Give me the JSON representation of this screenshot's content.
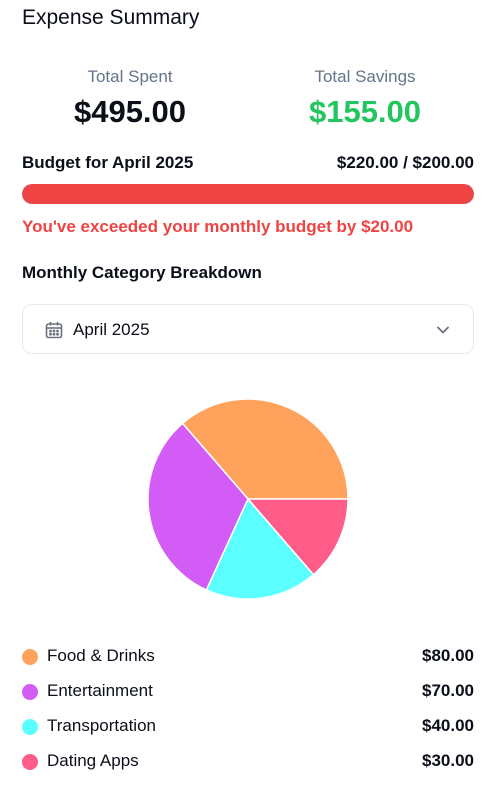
{
  "header": {
    "title": "Expense Summary"
  },
  "stats": {
    "total_spent": {
      "label": "Total Spent",
      "value": "$495.00"
    },
    "total_savings": {
      "label": "Total Savings",
      "value": "$155.00"
    }
  },
  "budget": {
    "label": "Budget for April 2025",
    "amount": "$220.00 / $200.00",
    "progress_fraction": 1.0,
    "warning": "You've exceeded your monthly budget by $20.00"
  },
  "breakdown": {
    "title": "Monthly Category Breakdown",
    "selected_month": "April 2025",
    "calendar_icon": "calendar-icon",
    "dropdown_icon": "chevron-down-icon"
  },
  "chart_data": {
    "type": "pie",
    "categories": [
      "Food & Drinks",
      "Entertainment",
      "Transportation",
      "Dating Apps"
    ],
    "values": [
      80,
      70,
      40,
      30
    ],
    "colors": [
      "#ffa25c",
      "#d45cf6",
      "#5cffff",
      "#ff5c8a"
    ]
  },
  "legend": [
    {
      "name": "Food & Drinks",
      "value": "$80.00",
      "color": "#ffa25c"
    },
    {
      "name": "Entertainment",
      "value": "$70.00",
      "color": "#d45cf6"
    },
    {
      "name": "Transportation",
      "value": "$40.00",
      "color": "#5cffff"
    },
    {
      "name": "Dating Apps",
      "value": "$30.00",
      "color": "#ff5c8a"
    }
  ],
  "colors": {
    "savings": "#22c55e",
    "danger": "#ef4444",
    "muted": "#64748b"
  }
}
